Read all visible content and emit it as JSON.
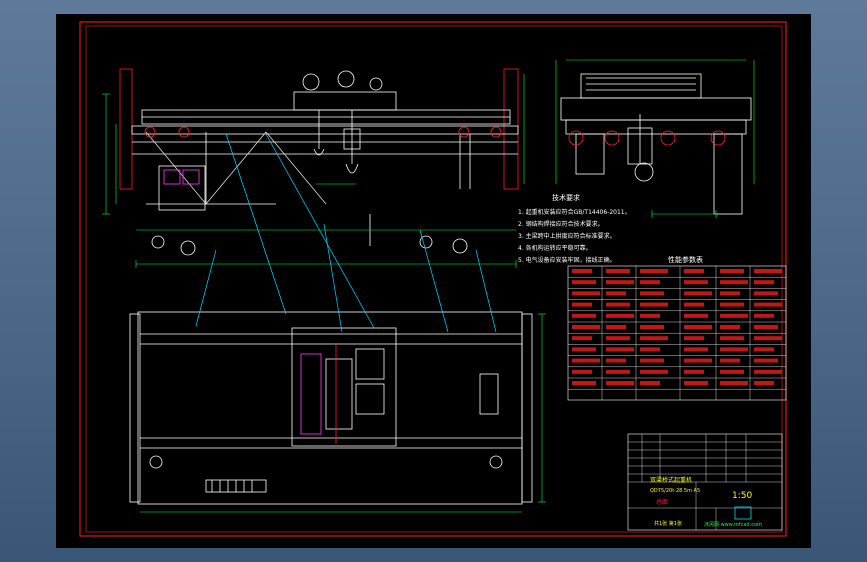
{
  "drawing": {
    "tech_requirements_title": "技术要求",
    "tech_requirements": [
      "1. 起重机安装应符合GB/T14406-2011。",
      "2. 钢结构焊接应符合技术要求。",
      "3. 主梁跨中上拱度应符合标准要求。",
      "4. 各机构运转应平稳可靠。",
      "5. 电气设备应安装牢固，接线正确。"
    ],
    "params_table_title": "性能参数表",
    "title_block": {
      "product_name": "双梁桥式起重机",
      "model": "QD75/20t-28.5m A5",
      "drawing_type": "总图",
      "company_caption": "沐风网 www.mfcad.com",
      "scale": "1:50",
      "sheet": "共1张 第1张"
    }
  },
  "colors": {
    "background": "#000000",
    "frame": "#ff2020",
    "geometry": "#ffffff",
    "dimension": "#00ff40",
    "leader": "#00d8ff",
    "hatch": "#ff40ff",
    "yellow": "#ffff00"
  }
}
